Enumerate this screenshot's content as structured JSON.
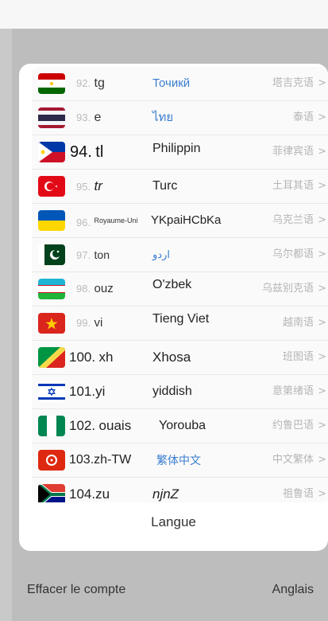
{
  "languages": [
    {
      "num": "92.",
      "code": "tg",
      "native": "Точикй",
      "native_color": "#3a7ed0",
      "zh": "塔吉克语",
      "flag": "tajikistan-flag"
    },
    {
      "num": "93.",
      "code": "e",
      "native": "ไทย",
      "native_color": "#3a7ed0",
      "zh": "泰语",
      "flag": "thailand-flag"
    },
    {
      "num": "94.",
      "code": "tl",
      "native": "Philippin",
      "native_color": "#222222",
      "zh": "菲律宾语",
      "flag": "philippines-flag"
    },
    {
      "num": "95.",
      "code": "tr",
      "native": "Turc",
      "native_color": "#222222",
      "zh": "土耳其语",
      "flag": "turkey-flag"
    },
    {
      "num": "96.",
      "code": "Royaume-Uni",
      "native": "YKpaiHCbKa",
      "native_color": "#222222",
      "zh": "乌克兰语",
      "flag": "ukraine-flag"
    },
    {
      "num": "97.",
      "code": "ton",
      "native": "اردو",
      "native_color": "#3a7ed0",
      "zh": "乌尔都语",
      "flag": "pakistan-flag"
    },
    {
      "num": "98.",
      "code": "ouz",
      "native": "O'zbek",
      "native_color": "#222222",
      "zh": "乌兹别克语",
      "flag": "uzbekistan-flag"
    },
    {
      "num": "99.",
      "code": "vi",
      "native": "Tieng Viet",
      "native_color": "#222222",
      "zh": "越南语",
      "flag": "vietnam-flag"
    },
    {
      "num": "100.",
      "code": "xh",
      "native": "Xhosa",
      "native_color": "#222222",
      "zh": "班图语",
      "flag": "congo-flag"
    },
    {
      "num": "101.",
      "code": "yi",
      "native": "yiddish",
      "native_color": "#222222",
      "zh": "意第绪语",
      "flag": "israel-flag"
    },
    {
      "num": "102.",
      "code": "ouais",
      "native": "Yorouba",
      "native_color": "#222222",
      "zh": "约鲁巴语",
      "flag": "nigeria-flag"
    },
    {
      "num": "103.",
      "code": "zh-TW",
      "native": "繁体中文",
      "native_color": "#3a7ed0",
      "zh": "中文繁体",
      "flag": "hongkong-flag"
    },
    {
      "num": "104.",
      "code": "zu",
      "native": "njnZ",
      "native_color": "#222222",
      "zh": "祖鲁语",
      "flag": "south-africa-flag"
    }
  ],
  "chevron": ">",
  "sheet_title": "Langue",
  "footer": {
    "delete_account": "Effacer le compte",
    "current_language": "Anglais"
  }
}
